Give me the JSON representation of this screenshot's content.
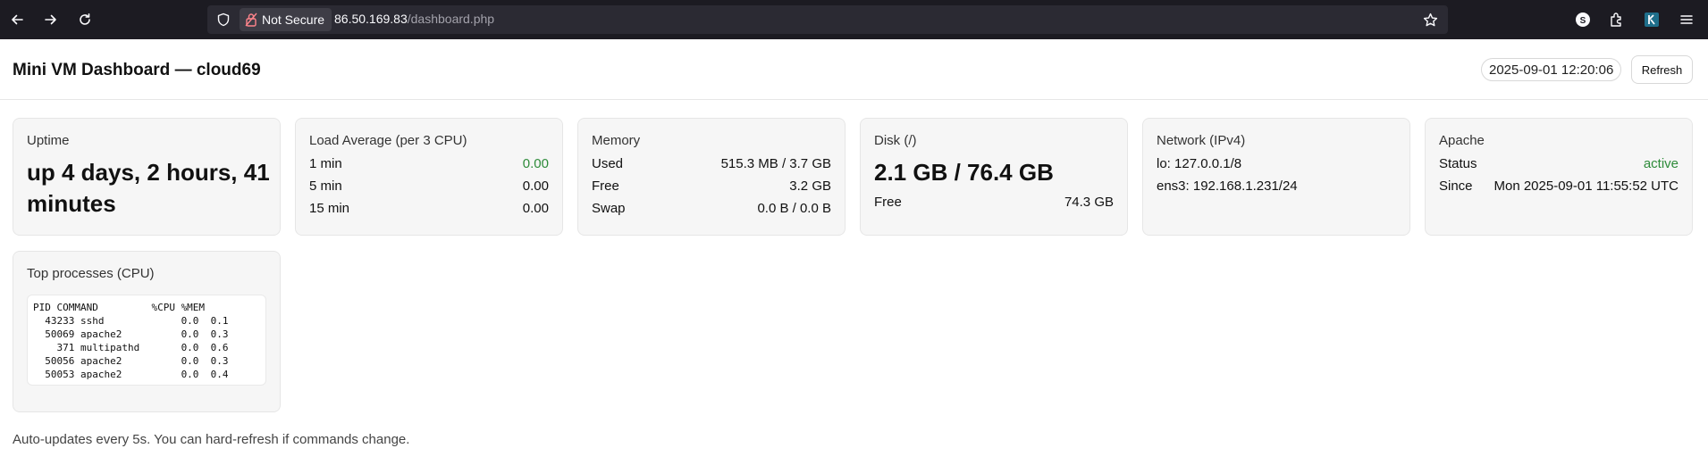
{
  "browser": {
    "security_label": "Not Secure",
    "url_host": "86.50.169.83",
    "url_path": "/dashboard.php"
  },
  "header": {
    "title": "Mini VM Dashboard — cloud69",
    "timestamp": "2025-09-01 12:20:06",
    "refresh_label": "Refresh"
  },
  "uptime": {
    "title": "Uptime",
    "line1": "up 4 days, 2 hours, 41",
    "line2": "minutes"
  },
  "load": {
    "title": "Load Average (per 3 CPU)",
    "rows": [
      {
        "label": "1 min",
        "value": "0.00"
      },
      {
        "label": "5 min",
        "value": "0.00"
      },
      {
        "label": "15 min",
        "value": "0.00"
      }
    ]
  },
  "memory": {
    "title": "Memory",
    "rows": [
      {
        "label": "Used",
        "value": "515.3 MB / 3.7 GB"
      },
      {
        "label": "Free",
        "value": "3.2 GB"
      },
      {
        "label": "Swap",
        "value": "0.0 B / 0.0 B"
      }
    ]
  },
  "disk": {
    "title": "Disk (/)",
    "usage": "2.1 GB / 76.4 GB",
    "free_label": "Free",
    "free_value": "74.3 GB"
  },
  "network": {
    "title": "Network (IPv4)",
    "lines": [
      "lo: 127.0.0.1/8",
      "ens3: 192.168.1.231/24"
    ]
  },
  "apache": {
    "title": "Apache",
    "status_label": "Status",
    "status_value": "active",
    "since_label": "Since",
    "since_value": "Mon 2025-09-01 11:55:52 UTC"
  },
  "processes": {
    "title": "Top processes (CPU)",
    "lines": [
      "PID COMMAND         %CPU %MEM",
      "  43233 sshd             0.0  0.1",
      "  50069 apache2          0.0  0.3",
      "    371 multipathd       0.0  0.6",
      "  50056 apache2          0.0  0.3",
      "  50053 apache2          0.0  0.4"
    ]
  },
  "footer": {
    "note": "Auto-updates every 5s. You can hard-refresh if commands change."
  },
  "colors": {
    "accent_green": "#2e8b3a",
    "chrome_bg": "#1c1b22"
  },
  "icons": [
    "back-arrow-icon",
    "forward-arrow-icon",
    "reload-icon",
    "shield-icon",
    "broken-lock-icon",
    "star-icon",
    "account-icon",
    "extensions-icon",
    "extension-badge-icon",
    "menu-icon"
  ]
}
